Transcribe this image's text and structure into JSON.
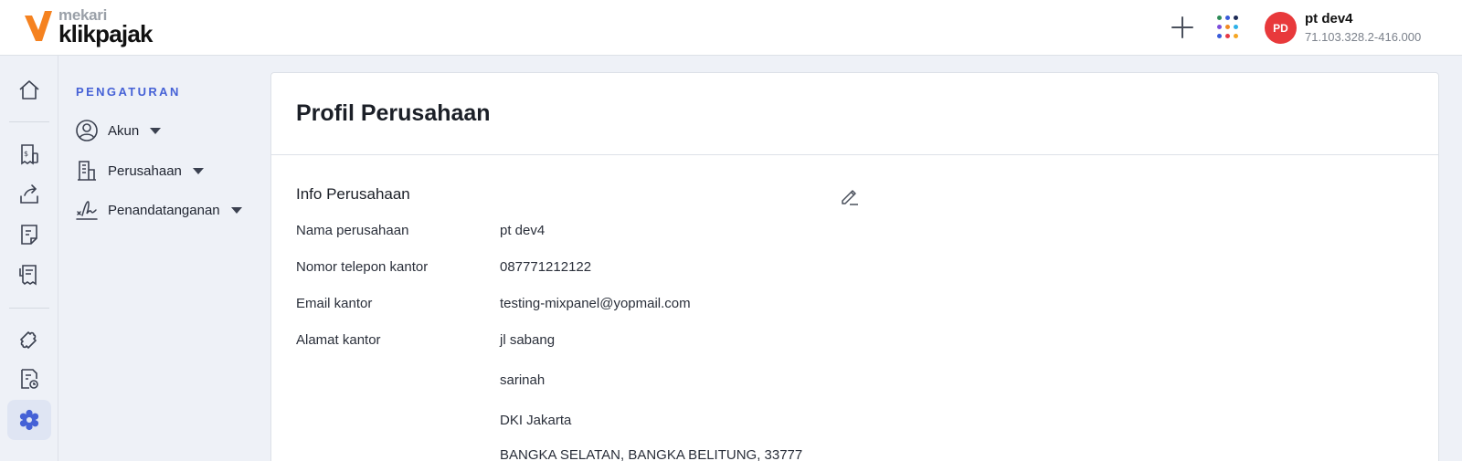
{
  "header": {
    "logo": {
      "mekari": "mekari",
      "brand": "klikpajak"
    },
    "company_name": "pt dev4",
    "company_npwp": "71.103.328.2-416.000",
    "avatar_initials": "PD",
    "apps_dot_colors": [
      "#2e8b57",
      "#3a5bd9",
      "#1d2a55",
      "#7c4ddb",
      "#f08a24",
      "#2db0e8",
      "#3a5bd9",
      "#e63946",
      "#f5a623"
    ]
  },
  "rail": {
    "items": [
      {
        "icon": "home-icon"
      },
      {
        "icon": "invoice-icon"
      },
      {
        "icon": "upload-icon"
      },
      {
        "icon": "document-icon"
      },
      {
        "icon": "receipt-icon"
      },
      {
        "icon": "puzzle-icon"
      },
      {
        "icon": "tax-report-icon"
      },
      {
        "icon": "gear-icon",
        "active": true
      }
    ],
    "accent": "#4561d6"
  },
  "settings_menu": {
    "title": "PENGATURAN",
    "items": [
      {
        "label": "Akun",
        "icon": "user-circle-icon"
      },
      {
        "label": "Perusahaan",
        "icon": "building-icon"
      },
      {
        "label": "Penandatanganan",
        "icon": "signature-icon"
      }
    ]
  },
  "main": {
    "title": "Profil Perusahaan",
    "section_title": "Info Perusahaan",
    "fields": [
      {
        "label": "Nama perusahaan",
        "value": "pt dev4"
      },
      {
        "label": "Nomor telepon kantor",
        "value": "087771212122"
      },
      {
        "label": "Email kantor",
        "value": "testing-mixpanel@yopmail.com"
      },
      {
        "label": "Alamat kantor",
        "value": "jl sabang"
      }
    ],
    "address_lines": [
      "sarinah",
      "DKI Jakarta",
      "BANGKA SELATAN, BANGKA BELITUNG, 33777"
    ]
  }
}
